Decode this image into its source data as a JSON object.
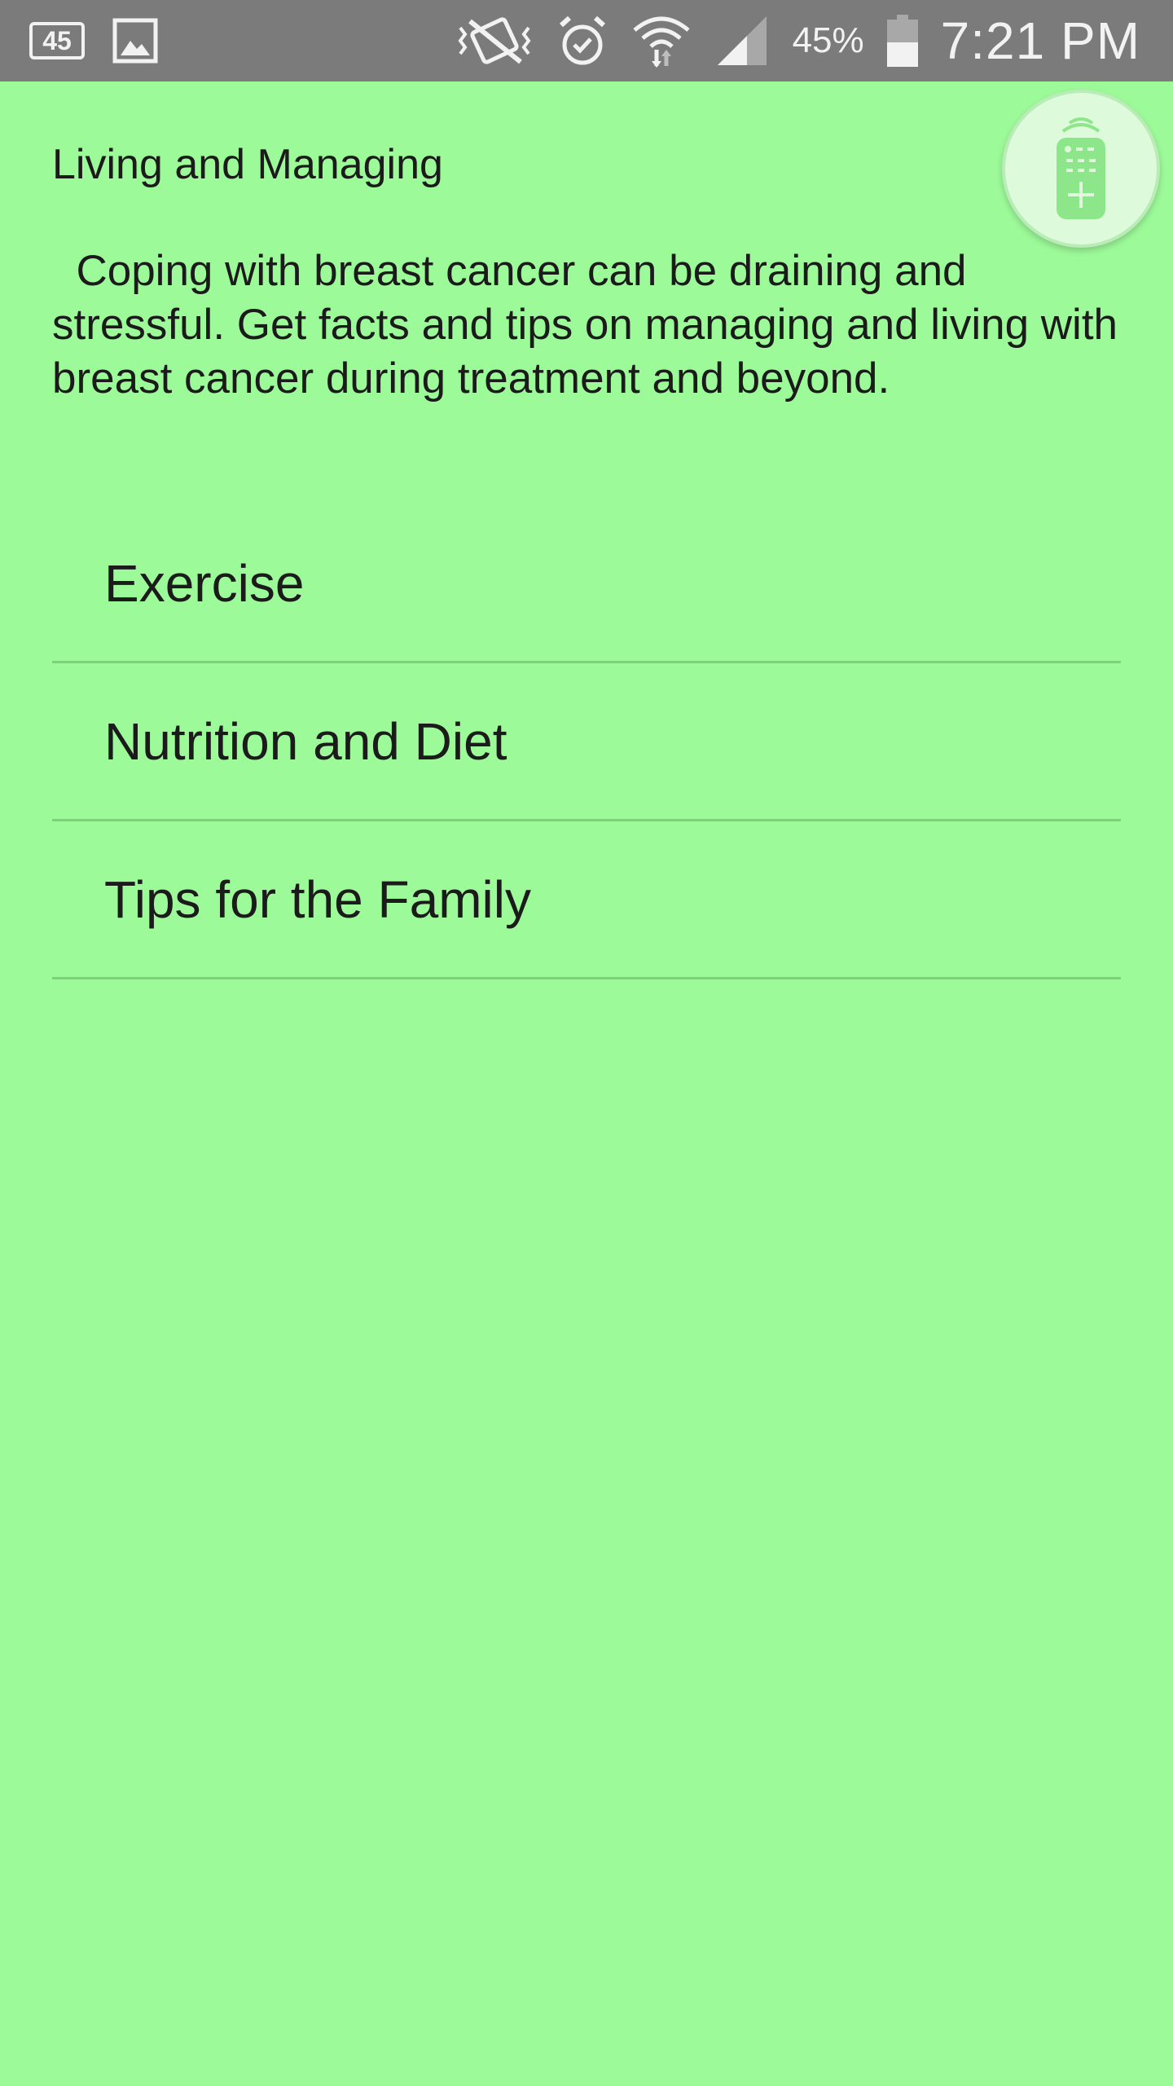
{
  "status_bar": {
    "notification_count": "45",
    "battery_percent": "45%",
    "time": "7:21 PM",
    "icons": [
      "notification-badge-icon",
      "image-icon",
      "vibrate-mute-icon",
      "alarm-icon",
      "wifi-icon",
      "signal-icon",
      "battery-icon"
    ]
  },
  "page": {
    "title": "Living and Managing",
    "intro": "  Coping with breast cancer can be draining and stressful. Get facts and tips on managing and living with breast cancer during treatment and beyond."
  },
  "menu": {
    "items": [
      {
        "label": "Exercise"
      },
      {
        "label": "Nutrition and Diet"
      },
      {
        "label": "Tips for the Family"
      }
    ]
  },
  "fab": {
    "icon": "remote-control-icon"
  },
  "colors": {
    "background": "#9dfa99",
    "status_bar": "#7b7b7b",
    "divider": "#7fcf7d",
    "fab_fill": "#ddfadb"
  }
}
